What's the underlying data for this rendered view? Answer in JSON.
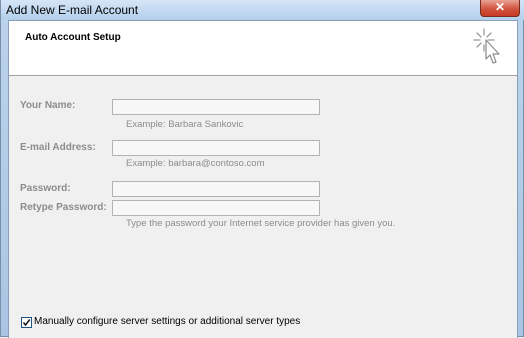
{
  "window": {
    "title": "Add New E-mail Account",
    "close_label": "✕"
  },
  "header": {
    "title": "Auto Account Setup"
  },
  "form": {
    "your_name": {
      "label": "Your Name:",
      "value": "",
      "hint": "Example: Barbara Sankovic"
    },
    "email": {
      "label": "E-mail Address:",
      "value": "",
      "hint": "Example: barbara@contoso.com"
    },
    "password": {
      "label": "Password:",
      "value": ""
    },
    "retype_password": {
      "label": "Retype Password:",
      "value": "",
      "hint": "Type the password your Internet service provider has given you."
    }
  },
  "manual_config": {
    "label": "Manually configure server settings or additional server types",
    "checked": true
  },
  "icons": {
    "close": "close-icon",
    "wizard": "wizard-cursor-icon",
    "checkmark": "checkmark-icon"
  }
}
